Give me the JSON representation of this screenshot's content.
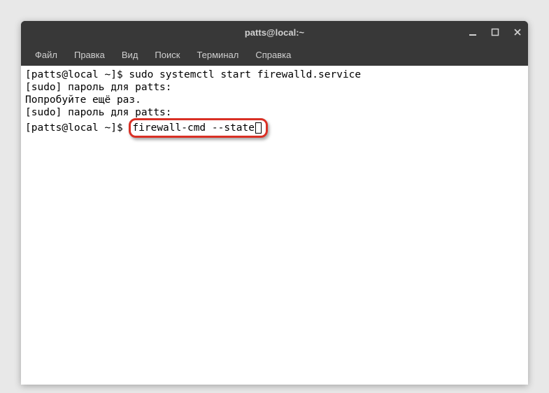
{
  "titlebar": {
    "title": "patts@local:~"
  },
  "menubar": {
    "items": [
      {
        "label": "Файл"
      },
      {
        "label": "Правка"
      },
      {
        "label": "Вид"
      },
      {
        "label": "Поиск"
      },
      {
        "label": "Терминал"
      },
      {
        "label": "Справка"
      }
    ]
  },
  "terminal": {
    "lines": {
      "0": "[patts@local ~]$ sudo systemctl start firewalld.service",
      "1": "[sudo] пароль для patts:",
      "2": "Попробуйте ещё раз.",
      "3": "[sudo] пароль для patts:",
      "4_prompt": "[patts@local ~]$ ",
      "4_command": "firewall-cmd --state"
    }
  }
}
